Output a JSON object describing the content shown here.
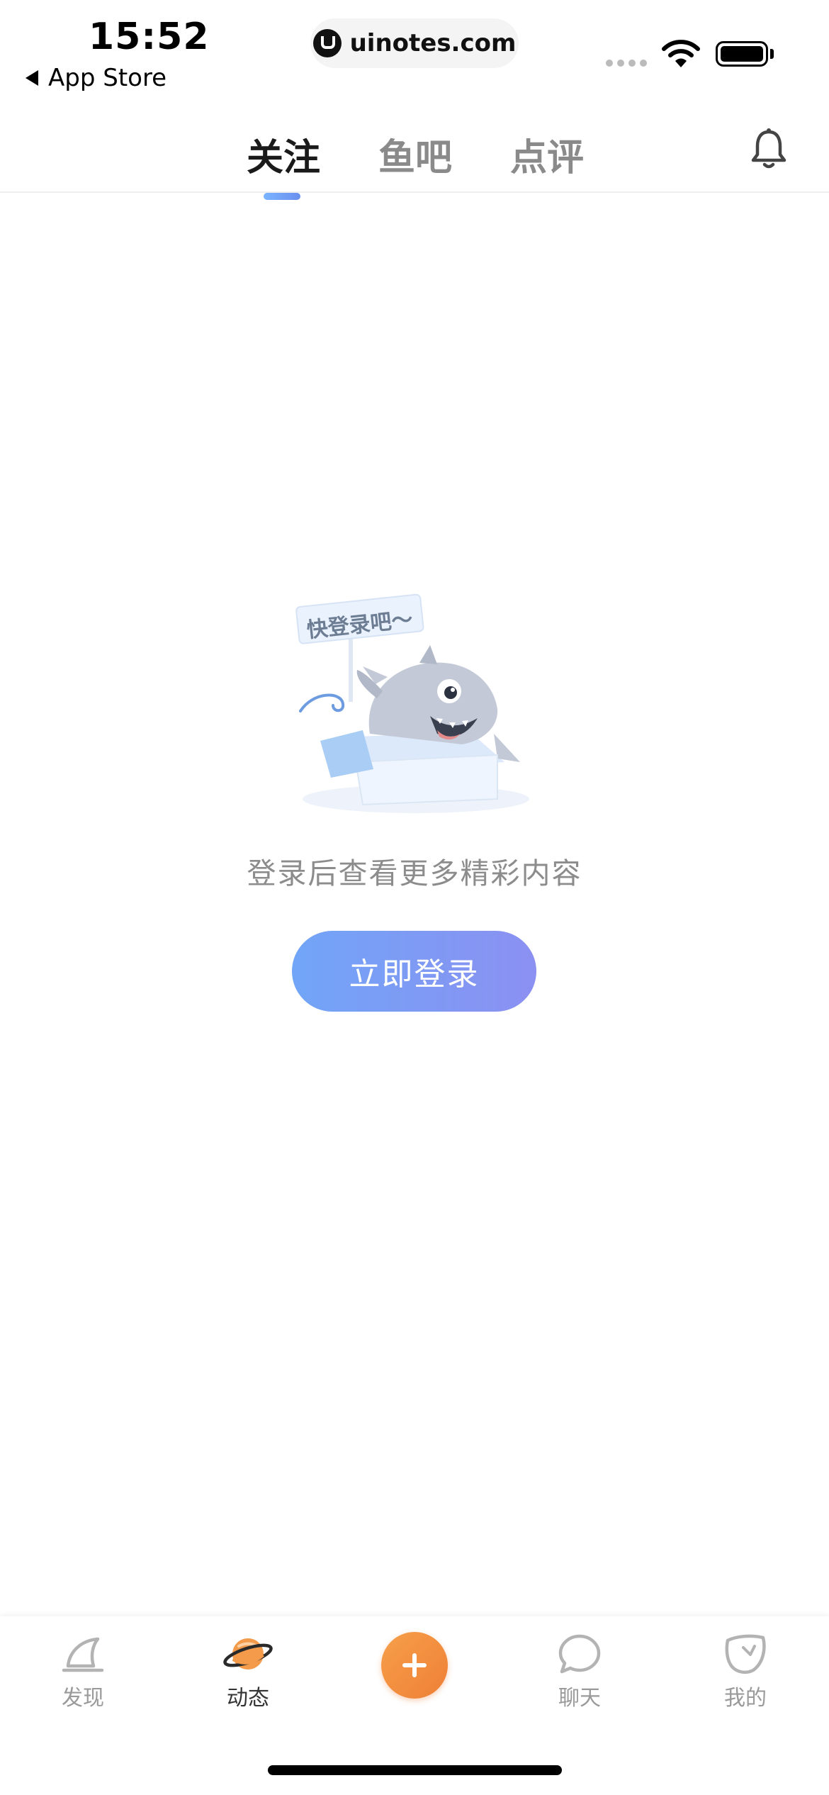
{
  "status_bar": {
    "time": "15:52",
    "back_label": "App Store",
    "url": "uinotes.com"
  },
  "top_tabs": [
    {
      "label": "关注",
      "active": true
    },
    {
      "label": "鱼吧",
      "active": false
    },
    {
      "label": "点评",
      "active": false
    }
  ],
  "empty_state": {
    "sign_text": "快登录吧～",
    "prompt": "登录后查看更多精彩内容",
    "login_button": "立即登录"
  },
  "bottom_nav": [
    {
      "label": "发现",
      "icon": "discover-icon",
      "active": false
    },
    {
      "label": "动态",
      "icon": "planet-icon",
      "active": true
    },
    {
      "label": "",
      "icon": "plus-icon",
      "active": false
    },
    {
      "label": "聊天",
      "icon": "chat-icon",
      "active": false
    },
    {
      "label": "我的",
      "icon": "profile-icon",
      "active": false
    }
  ],
  "colors": {
    "accent_gradient_start": "#71a5f7",
    "accent_gradient_end": "#8b90f1",
    "plus_orange": "#ef7f36"
  }
}
